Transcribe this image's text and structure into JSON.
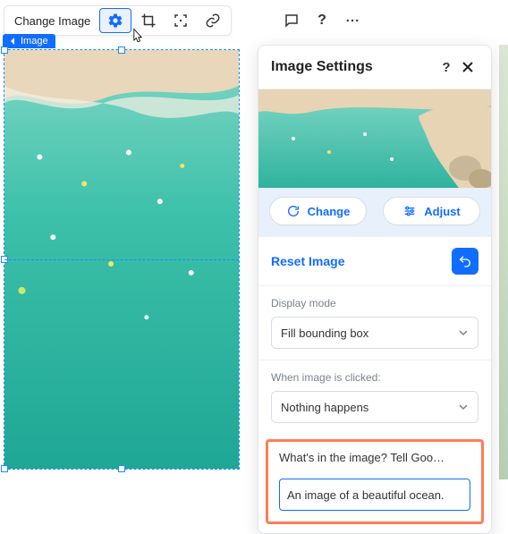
{
  "toolbar": {
    "change_image_label": "Change Image"
  },
  "canvas": {
    "label": "Image"
  },
  "panel": {
    "title": "Image Settings",
    "change_label": "Change",
    "adjust_label": "Adjust",
    "reset_label": "Reset Image",
    "display_mode_label": "Display mode",
    "display_mode_value": "Fill bounding box",
    "click_action_label": "When image is clicked:",
    "click_action_value": "Nothing happens",
    "alt_label": "What's in the image? Tell Goo…",
    "alt_value": "An image of a beautiful ocean."
  },
  "colors": {
    "accent": "#116dff",
    "highlight_border": "#ff7d55",
    "water": "#34bfa8",
    "sand": "#ead9be"
  }
}
